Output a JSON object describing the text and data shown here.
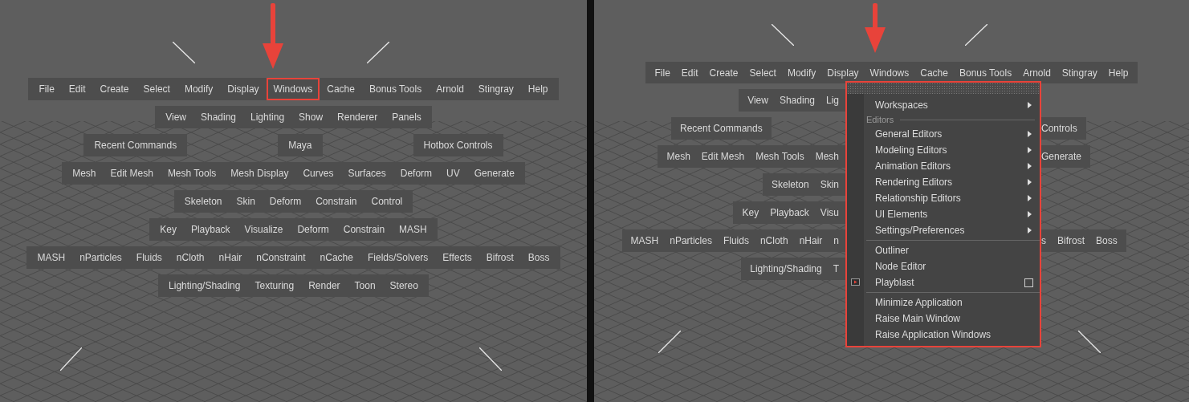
{
  "left_view": {
    "rows": [
      {
        "groups": [
          [
            {
              "label": "File",
              "highlighted": false
            },
            {
              "label": "Edit",
              "highlighted": false
            },
            {
              "label": "Create",
              "highlighted": false
            },
            {
              "label": "Select",
              "highlighted": false
            },
            {
              "label": "Modify",
              "highlighted": false
            },
            {
              "label": "Display",
              "highlighted": false
            },
            {
              "label": "Windows",
              "highlighted": true
            },
            {
              "label": "Cache",
              "highlighted": false
            },
            {
              "label": "Bonus Tools",
              "highlighted": false
            },
            {
              "label": "Arnold",
              "highlighted": false
            },
            {
              "label": "Stingray",
              "highlighted": false
            },
            {
              "label": "Help",
              "highlighted": false
            }
          ]
        ]
      },
      {
        "groups": [
          [
            {
              "label": "View",
              "highlighted": false
            },
            {
              "label": "Shading",
              "highlighted": false
            },
            {
              "label": "Lighting",
              "highlighted": false
            },
            {
              "label": "Show",
              "highlighted": false
            },
            {
              "label": "Renderer",
              "highlighted": false
            },
            {
              "label": "Panels",
              "highlighted": false
            }
          ]
        ]
      },
      {
        "groups": [
          [
            {
              "label": "Recent Commands",
              "highlighted": false
            }
          ],
          [
            {
              "label": "Maya",
              "highlighted": false
            }
          ],
          [
            {
              "label": "Hotbox Controls",
              "highlighted": false
            }
          ]
        ]
      },
      {
        "groups": [
          [
            {
              "label": "Mesh",
              "highlighted": false
            },
            {
              "label": "Edit Mesh",
              "highlighted": false
            },
            {
              "label": "Mesh Tools",
              "highlighted": false
            },
            {
              "label": "Mesh Display",
              "highlighted": false
            },
            {
              "label": "Curves",
              "highlighted": false
            },
            {
              "label": "Surfaces",
              "highlighted": false
            },
            {
              "label": "Deform",
              "highlighted": false
            },
            {
              "label": "UV",
              "highlighted": false
            },
            {
              "label": "Generate",
              "highlighted": false
            }
          ]
        ]
      },
      {
        "groups": [
          [
            {
              "label": "Skeleton",
              "highlighted": false
            },
            {
              "label": "Skin",
              "highlighted": false
            },
            {
              "label": "Deform",
              "highlighted": false
            },
            {
              "label": "Constrain",
              "highlighted": false
            },
            {
              "label": "Control",
              "highlighted": false
            }
          ]
        ]
      },
      {
        "groups": [
          [
            {
              "label": "Key",
              "highlighted": false
            },
            {
              "label": "Playback",
              "highlighted": false
            },
            {
              "label": "Visualize",
              "highlighted": false
            },
            {
              "label": "Deform",
              "highlighted": false
            },
            {
              "label": "Constrain",
              "highlighted": false
            },
            {
              "label": "MASH",
              "highlighted": false
            }
          ]
        ]
      },
      {
        "groups": [
          [
            {
              "label": "MASH",
              "highlighted": false
            },
            {
              "label": "nParticles",
              "highlighted": false
            },
            {
              "label": "Fluids",
              "highlighted": false
            },
            {
              "label": "nCloth",
              "highlighted": false
            },
            {
              "label": "nHair",
              "highlighted": false
            },
            {
              "label": "nConstraint",
              "highlighted": false
            },
            {
              "label": "nCache",
              "highlighted": false
            },
            {
              "label": "Fields/Solvers",
              "highlighted": false
            },
            {
              "label": "Effects",
              "highlighted": false
            },
            {
              "label": "Bifrost",
              "highlighted": false
            },
            {
              "label": "Boss",
              "highlighted": false
            }
          ]
        ]
      },
      {
        "groups": [
          [
            {
              "label": "Lighting/Shading",
              "highlighted": false
            },
            {
              "label": "Texturing",
              "highlighted": false
            },
            {
              "label": "Render",
              "highlighted": false
            },
            {
              "label": "Toon",
              "highlighted": false
            },
            {
              "label": "Stereo",
              "highlighted": false
            }
          ]
        ]
      }
    ]
  },
  "right_view": {
    "rows": [
      {
        "kind": "full",
        "left": [
          "File",
          "Edit",
          "Create",
          "Select",
          "Modify",
          "Display",
          "Windows",
          "Cache",
          "Bonus Tools",
          "Arnold",
          "Stingray",
          "Help"
        ]
      },
      {
        "kind": "split",
        "left": [
          "View",
          "Shading",
          "Lig"
        ]
      },
      {
        "kind": "split",
        "left": [
          "Recent Commands"
        ],
        "right": [
          "Controls"
        ]
      },
      {
        "kind": "split",
        "left": [
          "Mesh",
          "Edit Mesh",
          "Mesh Tools",
          "Mesh"
        ],
        "right": [
          "Generate"
        ]
      },
      {
        "kind": "split",
        "left": [
          "Skeleton",
          "Skin"
        ]
      },
      {
        "kind": "split",
        "left": [
          "Key",
          "Playback",
          "Visu"
        ]
      },
      {
        "kind": "split",
        "left": [
          "MASH",
          "nParticles",
          "Fluids",
          "nCloth",
          "nHair",
          "n"
        ],
        "right": [
          "s",
          "Bifrost",
          "Boss"
        ]
      },
      {
        "kind": "split",
        "left": [
          "Lighting/Shading",
          "T"
        ]
      }
    ],
    "windows_menu": {
      "outlined": true,
      "items": [
        {
          "kind": "item",
          "label": "Workspaces",
          "submenu": true,
          "option_box": false,
          "icon": false
        },
        {
          "kind": "section",
          "label": "Editors"
        },
        {
          "kind": "item",
          "label": "General Editors",
          "submenu": true,
          "option_box": false,
          "icon": false
        },
        {
          "kind": "item",
          "label": "Modeling Editors",
          "submenu": true,
          "option_box": false,
          "icon": false
        },
        {
          "kind": "item",
          "label": "Animation Editors",
          "submenu": true,
          "option_box": false,
          "icon": false
        },
        {
          "kind": "item",
          "label": "Rendering Editors",
          "submenu": true,
          "option_box": false,
          "icon": false
        },
        {
          "kind": "item",
          "label": "Relationship Editors",
          "submenu": true,
          "option_box": false,
          "icon": false
        },
        {
          "kind": "item",
          "label": "UI Elements",
          "submenu": true,
          "option_box": false,
          "icon": false
        },
        {
          "kind": "item",
          "label": "Settings/Preferences",
          "submenu": true,
          "option_box": false,
          "icon": false
        },
        {
          "kind": "separator"
        },
        {
          "kind": "item",
          "label": "Outliner",
          "submenu": false,
          "option_box": false,
          "icon": false
        },
        {
          "kind": "item",
          "label": "Node Editor",
          "submenu": false,
          "option_box": false,
          "icon": false
        },
        {
          "kind": "item",
          "label": "Playblast",
          "submenu": false,
          "option_box": true,
          "icon": true
        },
        {
          "kind": "separator"
        },
        {
          "kind": "item",
          "label": "Minimize Application",
          "submenu": false,
          "option_box": false,
          "icon": false
        },
        {
          "kind": "item",
          "label": "Raise Main Window",
          "submenu": false,
          "option_box": false,
          "icon": false
        },
        {
          "kind": "item",
          "label": "Raise Application Windows",
          "submenu": false,
          "option_box": false,
          "icon": false
        }
      ]
    }
  }
}
